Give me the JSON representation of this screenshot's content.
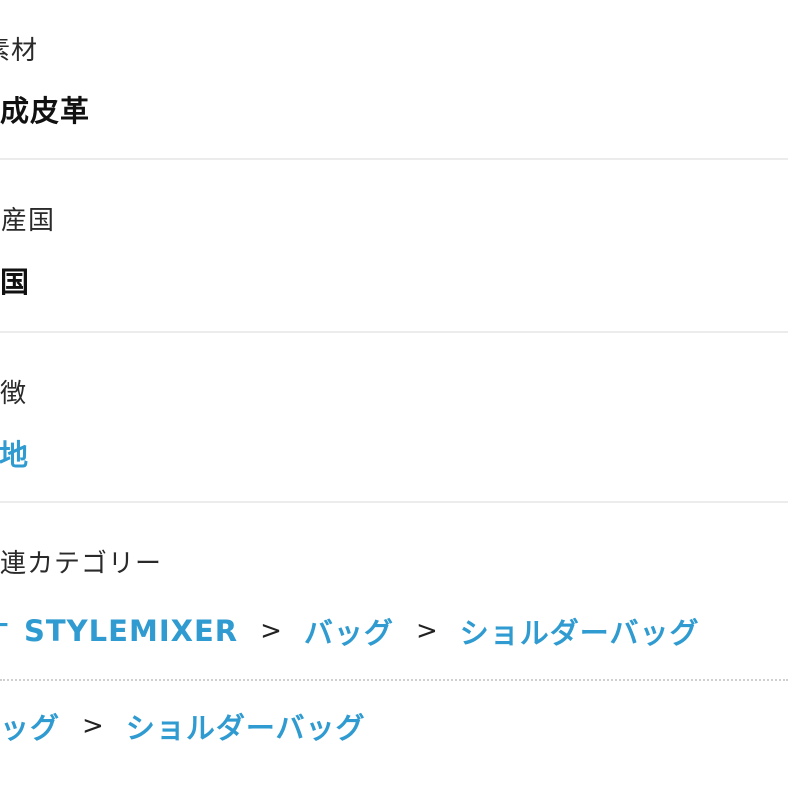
{
  "material": {
    "label": "素材",
    "value": "合成皮革"
  },
  "origin": {
    "label": "生産国",
    "value": "中国"
  },
  "feature": {
    "label": "特徴",
    "value": "無地"
  },
  "related": {
    "label": "関連カテゴリー",
    "row1": {
      "prefix": "す",
      "root": "STYLEMIXER",
      "sep1": ">",
      "category": "バッグ",
      "sep2": ">",
      "subcategory": "ショルダーバッグ"
    },
    "row2": {
      "category": "バッグ",
      "sep1": ">",
      "subcategory": "ショルダーバッグ"
    }
  },
  "colors": {
    "link": "#2f9bd0",
    "divider": "#ececec"
  }
}
